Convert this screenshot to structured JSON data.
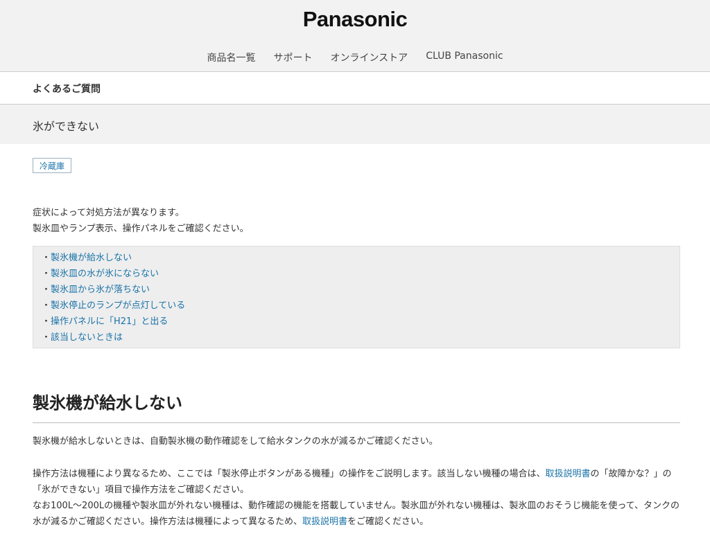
{
  "header": {
    "logo_text": "Panasonic",
    "nav": [
      "商品名一覧",
      "サポート",
      "オンラインストア",
      "CLUB Panasonic"
    ]
  },
  "breadcrumb": "よくあるご質問",
  "page_title": "氷ができない",
  "category_tag": "冷蔵庫",
  "intro": {
    "line1": "症状によって対処方法が異なります。",
    "line2": "製氷皿やランプ表示、操作パネルをご確認ください。"
  },
  "toc": {
    "bullet": "・",
    "items": [
      "製氷機が給水しない",
      "製氷皿の水が氷にならない",
      "製氷皿から氷が落ちない",
      "製氷停止のランプが点灯している",
      "操作パネルに「H21」と出る",
      "該当しないときは"
    ]
  },
  "section": {
    "heading": "製氷機が給水しない",
    "para1": "製氷機が給水しないときは、自動製氷機の動作確認をして給水タンクの水が減るかご確認ください。",
    "para2_a": "操作方法は機種により異なるため、ここでは「製氷停止ボタンがある機種」の操作をご説明します。該当しない機種の場合は、",
    "para2_link": "取扱説明書",
    "para2_b": "の「故障かな？」の「氷ができない」項目で操作方法をご確認ください。",
    "para2_c": "なお100L～200Lの機種や製氷皿が外れない機種は、動作確認の機能を搭載していません。製氷皿が外れない機種は、製氷皿のおそうじ機能を使って、タンクの水が減るかご確認ください。操作方法は機種によって異なるため、",
    "para2_link2": "取扱説明書",
    "para2_d": "をご確認ください。"
  }
}
